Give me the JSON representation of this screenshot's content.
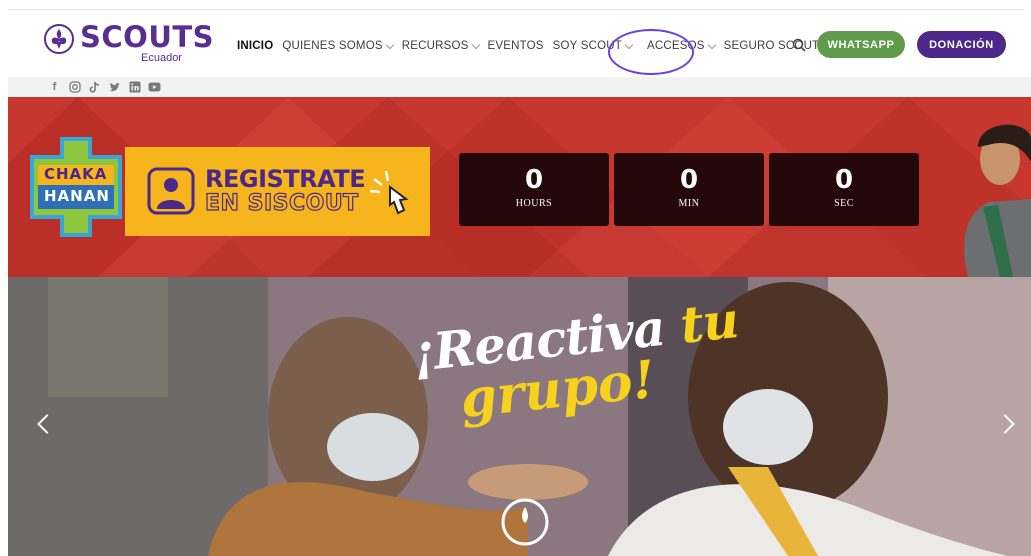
{
  "header": {
    "logo_word": "SCOUTS",
    "logo_sub": "Ecuador",
    "nav": [
      {
        "label": "INICIO",
        "dropdown": false
      },
      {
        "label": "QUIENES SOMOS",
        "dropdown": true
      },
      {
        "label": "RECURSOS",
        "dropdown": true
      },
      {
        "label": "EVENTOS",
        "dropdown": false
      },
      {
        "label": "SOY SCOUT",
        "dropdown": true
      },
      {
        "label": "ACCESOS",
        "dropdown": true
      },
      {
        "label": "SEGURO SCOUT",
        "dropdown": false
      }
    ],
    "whatsapp_label": "WHATSAPP",
    "donation_label": "DONACIÓN"
  },
  "social": [
    "facebook-icon",
    "instagram-icon",
    "tiktok-icon",
    "twitter-icon",
    "linkedin-icon",
    "youtube-icon"
  ],
  "banner": {
    "event_logo": {
      "line1": "CHAKA",
      "line2": "HANAN"
    },
    "register_line1": "REGISTRATE",
    "register_line2": "EN SISCOUT",
    "countdown": [
      {
        "value": "0",
        "label": "HOURS"
      },
      {
        "value": "0",
        "label": "MIN"
      },
      {
        "value": "0",
        "label": "SEC"
      }
    ]
  },
  "hero": {
    "title_part1": "¡Reactiva ",
    "title_part2": "tu",
    "title_line2": "grupo!"
  },
  "colors": {
    "brand_purple": "#4b2889",
    "whatsapp_green": "#5f9b4a",
    "banner_red": "#c8372f",
    "accent_yellow": "#f6b51c"
  }
}
